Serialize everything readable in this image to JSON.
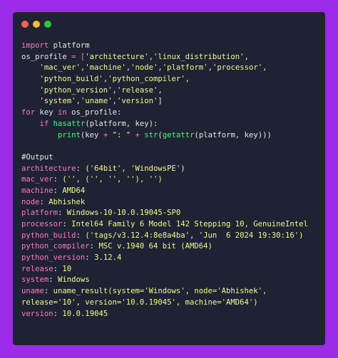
{
  "window": {
    "controls": {
      "close": "close-dot",
      "minimize": "minimize-dot",
      "maximize": "maximize-dot"
    }
  },
  "code": {
    "l1": {
      "kw": "import",
      "rest": " platform"
    },
    "l2": {
      "a": "os_profile",
      "b": " = [",
      "s1": "'architecture'",
      "c": ",",
      "s2": "'linux_distribution'",
      "d": ","
    },
    "l3": {
      "pad": "    ",
      "s1": "'mac_ver'",
      "c1": ",",
      "s2": "'machine'",
      "c2": ",",
      "s3": "'node'",
      "c3": ",",
      "s4": "'platform'",
      "c4": ",",
      "s5": "'processor'",
      "c5": ","
    },
    "l4": {
      "pad": "    ",
      "s1": "'python_build'",
      "c1": ",",
      "s2": "'python_compiler'",
      "c2": ","
    },
    "l5": {
      "pad": "    ",
      "s1": "'python_version'",
      "c1": ",",
      "s2": "'release'",
      "c2": ","
    },
    "l6": {
      "pad": "    ",
      "s1": "'system'",
      "c1": ",",
      "s2": "'uname'",
      "c2": ",",
      "s3": "'version'",
      "c3": "]"
    },
    "l7": {
      "kw1": "for",
      "a": " key ",
      "kw2": "in",
      "b": " os_profile:"
    },
    "l8": {
      "pad": "    ",
      "kw": "if",
      "sp": " ",
      "fn": "hasattr",
      "rest": "(platform, key):"
    },
    "l9": {
      "pad": "        ",
      "fn1": "print",
      "a": "(key ",
      "op1": "+",
      "sp1": " ",
      "s1": "\": \"",
      "sp2": " ",
      "op2": "+",
      "sp3": " ",
      "fn2": "str",
      "b": "(",
      "fn3": "getattr",
      "c": "(platform, key)))"
    },
    "l11": {
      "text": "#Output"
    }
  },
  "output": [
    {
      "key": "architecture",
      "sep": ": ",
      "val": "('64bit', 'WindowsPE')"
    },
    {
      "key": "mac_ver",
      "sep": ": ",
      "val": "('', ('', '', ''), '')"
    },
    {
      "key": "machine",
      "sep": ": ",
      "val": "AMD64"
    },
    {
      "key": "node",
      "sep": ": ",
      "val": "Abhishek"
    },
    {
      "key": "platform",
      "sep": ": ",
      "val": "Windows-10-10.0.19045-SP0"
    },
    {
      "key": "processor",
      "sep": ": ",
      "val": "Intel64 Family 6 Model 142 Stepping 10, GenuineIntel"
    },
    {
      "key": "python_build",
      "sep": ": ",
      "val": "('tags/v3.12.4:8e8a4ba', 'Jun  6 2024 19:30:16')"
    },
    {
      "key": "python_compiler",
      "sep": ": ",
      "val": "MSC v.1940 64 bit (AMD64)"
    },
    {
      "key": "python_version",
      "sep": ": ",
      "val": "3.12.4"
    },
    {
      "key": "release",
      "sep": ": ",
      "val": "10"
    },
    {
      "key": "system",
      "sep": ": ",
      "val": "Windows"
    },
    {
      "key": "uname",
      "sep": ": ",
      "val": "uname_result(system='Windows', node='Abhishek',"
    },
    {
      "key": "",
      "sep": "",
      "val": "release='10', version='10.0.19045', machine='AMD64')"
    },
    {
      "key": "version",
      "sep": ": ",
      "val": "10.0.19045"
    }
  ],
  "colors": {
    "background": "#9b2be6",
    "window": "#1f2233",
    "keyword": "#ff79c6",
    "function": "#50fa7b",
    "string": "#f1fa8c",
    "text": "#e6e6e6"
  }
}
